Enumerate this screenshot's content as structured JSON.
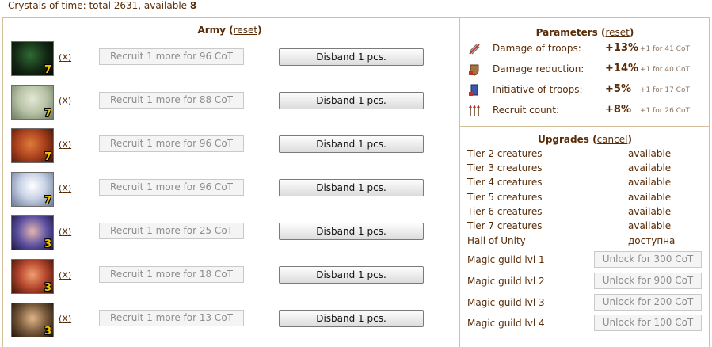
{
  "header": {
    "crystals_text": "Crystals of time: total 2631, available ",
    "available": "8"
  },
  "army": {
    "title": "Army",
    "reset_label": "reset",
    "rows": [
      {
        "level": "7",
        "remove_label": "X",
        "recruit_label": "Recruit 1 more for 96 CoT",
        "disband_label": "Disband 1 pcs.",
        "color": "#1d3a1d"
      },
      {
        "level": "7",
        "remove_label": "X",
        "recruit_label": "Recruit 1 more for 88 CoT",
        "disband_label": "Disband 1 pcs.",
        "color": "#b7c2a6"
      },
      {
        "level": "7",
        "remove_label": "X",
        "recruit_label": "Recruit 1 more for 96 CoT",
        "disband_label": "Disband 1 pcs.",
        "color": "#a8401c"
      },
      {
        "level": "7",
        "remove_label": "X",
        "recruit_label": "Recruit 1 more for 96 CoT",
        "disband_label": "Disband 1 pcs.",
        "color": "#c9d2e6"
      },
      {
        "level": "3",
        "remove_label": "X",
        "recruit_label": "Recruit 1 more for 25 CoT",
        "disband_label": "Disband 1 pcs.",
        "color": "#5a4fa0"
      },
      {
        "level": "3",
        "remove_label": "X",
        "recruit_label": "Recruit 1 more for 18 CoT",
        "disband_label": "Disband 1 pcs.",
        "color": "#b4452c"
      },
      {
        "level": "3",
        "remove_label": "X",
        "recruit_label": "Recruit 1 more for 13 CoT",
        "disband_label": "Disband 1 pcs.",
        "color": "#7a5a3c"
      }
    ]
  },
  "parameters": {
    "title": "Parameters",
    "reset_label": "reset",
    "items": [
      {
        "icon": "damage-icon",
        "label": "Damage of troops:",
        "value": "+13%",
        "cost": "+1 for 41 CoT"
      },
      {
        "icon": "shield-icon",
        "label": "Damage reduction:",
        "value": "+14%",
        "cost": "+1 for 40 CoT"
      },
      {
        "icon": "initiative-icon",
        "label": "Initiative of troops:",
        "value": "+5%",
        "cost": "+1 for 17 CoT"
      },
      {
        "icon": "recruit-icon",
        "label": "Recruit count:",
        "value": "+8%",
        "cost": "+1 for 26 CoT"
      }
    ]
  },
  "upgrades": {
    "title": "Upgrades",
    "cancel_label": "cancel",
    "items": [
      {
        "label": "Tier 2 creatures",
        "status": "available"
      },
      {
        "label": "Tier 3 creatures",
        "status": "available"
      },
      {
        "label": "Tier 4 creatures",
        "status": "available"
      },
      {
        "label": "Tier 5 creatures",
        "status": "available"
      },
      {
        "label": "Tier 6 creatures",
        "status": "available"
      },
      {
        "label": "Tier 7 creatures",
        "status": "available"
      },
      {
        "label": "Hall of Unity",
        "status": "доступна"
      }
    ],
    "magic": [
      {
        "label": "Magic guild lvl 1",
        "button": "Unlock for 300 CoT"
      },
      {
        "label": "Magic guild lvl 2",
        "button": "Unlock for 900 CoT"
      },
      {
        "label": "Magic guild lvl 3",
        "button": "Unlock for 200 CoT"
      },
      {
        "label": "Magic guild lvl 4",
        "button": "Unlock for 100 CoT"
      }
    ]
  }
}
